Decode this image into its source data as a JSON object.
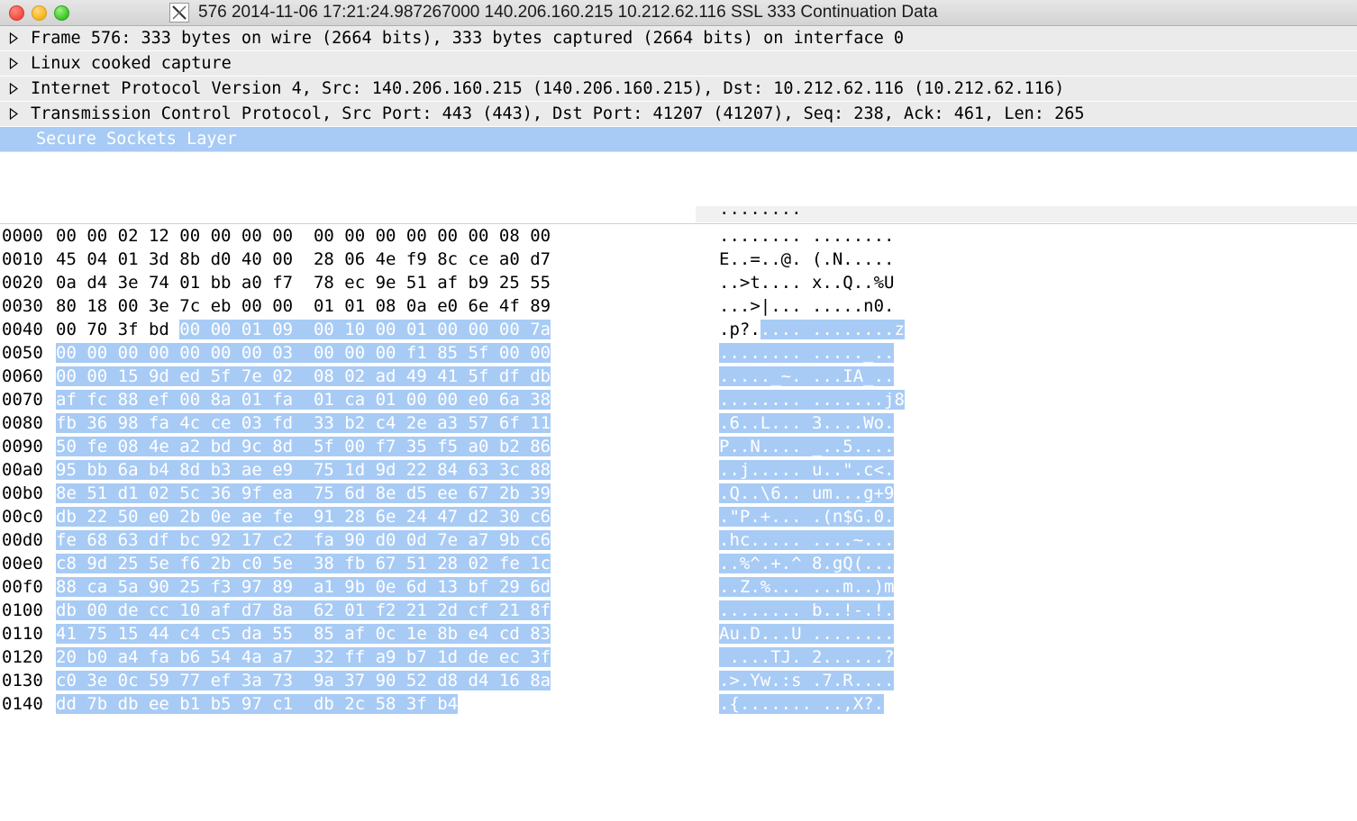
{
  "window": {
    "title": "576 2014-11-06 17:21:24.987267000 140.206.160.215 10.212.62.116 SSL 333 Continuation Data",
    "app_icon": "x11-icon",
    "buttons": {
      "close": "close-button",
      "minimize": "minimize-button",
      "maximize": "maximize-button"
    }
  },
  "colors": {
    "selection_blue": "#a8cbf5",
    "row_gray": "#ebebeb",
    "titlebar": "#dcdcdc",
    "close_red": "#f24b42",
    "minimize_yellow": "#f5b51b",
    "maximize_green": "#3bc428"
  },
  "protocol_tree": {
    "rows": [
      {
        "label": "Frame 576: 333 bytes on wire (2664 bits), 333 bytes captured (2664 bits) on interface 0",
        "expanded": false,
        "selected": false,
        "disclosure": "triangle-right-icon"
      },
      {
        "label": "Linux cooked capture",
        "expanded": false,
        "selected": false,
        "disclosure": "triangle-right-icon"
      },
      {
        "label": "Internet Protocol Version 4, Src: 140.206.160.215 (140.206.160.215), Dst: 10.212.62.116 (10.212.62.116)",
        "expanded": false,
        "selected": false,
        "disclosure": "triangle-right-icon"
      },
      {
        "label": "Transmission Control Protocol, Src Port: 443 (443), Dst Port: 41207 (41207), Seq: 238, Ack: 461, Len: 265",
        "expanded": false,
        "selected": false,
        "disclosure": "triangle-right-icon"
      },
      {
        "label": "Secure Sockets Layer",
        "expanded": false,
        "selected": true,
        "disclosure": "none"
      }
    ]
  },
  "hex_dump": {
    "clipped_top_row_ascii": "........",
    "rows": [
      {
        "offset": "0000",
        "bytes_plain": "00 00 02 12 00 00 00 00  00 00 00 00 00 00 08 00",
        "bytes_sel": "",
        "ascii_plain": "........ ........",
        "ascii_sel": ""
      },
      {
        "offset": "0010",
        "bytes_plain": "45 04 01 3d 8b d0 40 00  28 06 4e f9 8c ce a0 d7",
        "bytes_sel": "",
        "ascii_plain": "E..=..@. (.N.....",
        "ascii_sel": ""
      },
      {
        "offset": "0020",
        "bytes_plain": "0a d4 3e 74 01 bb a0 f7  78 ec 9e 51 af b9 25 55",
        "bytes_sel": "",
        "ascii_plain": "..>t.... x..Q..%U",
        "ascii_sel": ""
      },
      {
        "offset": "0030",
        "bytes_plain": "80 18 00 3e 7c eb 00 00  01 01 08 0a e0 6e 4f 89",
        "bytes_sel": "",
        "ascii_plain": "...>|... .....n0.",
        "ascii_sel": ""
      },
      {
        "offset": "0040",
        "bytes_plain": "00 70 3f bd ",
        "bytes_sel": "00 00 01 09  00 10 00 01 00 00 00 7a",
        "ascii_plain": ".p?.",
        "ascii_sel": ".... ........z"
      },
      {
        "offset": "0050",
        "bytes_plain": "",
        "bytes_sel": "00 00 00 00 00 00 00 03  00 00 00 f1 85 5f 00 00",
        "ascii_plain": "",
        "ascii_sel": "........ ....._.."
      },
      {
        "offset": "0060",
        "bytes_plain": "",
        "bytes_sel": "00 00 15 9d ed 5f 7e 02  08 02 ad 49 41 5f df db",
        "ascii_plain": "",
        "ascii_sel": "....._~. ...IA_.."
      },
      {
        "offset": "0070",
        "bytes_plain": "",
        "bytes_sel": "af fc 88 ef 00 8a 01 fa  01 ca 01 00 00 e0 6a 38",
        "ascii_plain": "",
        "ascii_sel": "........ .......j8"
      },
      {
        "offset": "0080",
        "bytes_plain": "",
        "bytes_sel": "fb 36 98 fa 4c ce 03 fd  33 b2 c4 2e a3 57 6f 11",
        "ascii_plain": "",
        "ascii_sel": ".6..L... 3....Wo."
      },
      {
        "offset": "0090",
        "bytes_plain": "",
        "bytes_sel": "50 fe 08 4e a2 bd 9c 8d  5f 00 f7 35 f5 a0 b2 86",
        "ascii_plain": "",
        "ascii_sel": "P..N.... _..5...."
      },
      {
        "offset": "00a0",
        "bytes_plain": "",
        "bytes_sel": "95 bb 6a b4 8d b3 ae e9  75 1d 9d 22 84 63 3c 88",
        "ascii_plain": "",
        "ascii_sel": "..j..... u..\".c<."
      },
      {
        "offset": "00b0",
        "bytes_plain": "",
        "bytes_sel": "8e 51 d1 02 5c 36 9f ea  75 6d 8e d5 ee 67 2b 39",
        "ascii_plain": "",
        "ascii_sel": ".Q..\\6.. um...g+9"
      },
      {
        "offset": "00c0",
        "bytes_plain": "",
        "bytes_sel": "db 22 50 e0 2b 0e ae fe  91 28 6e 24 47 d2 30 c6",
        "ascii_plain": "",
        "ascii_sel": ".\"P.+... .(n$G.0."
      },
      {
        "offset": "00d0",
        "bytes_plain": "",
        "bytes_sel": "fe 68 63 df bc 92 17 c2  fa 90 d0 0d 7e a7 9b c6",
        "ascii_plain": "",
        "ascii_sel": ".hc..... ....~..."
      },
      {
        "offset": "00e0",
        "bytes_plain": "",
        "bytes_sel": "c8 9d 25 5e f6 2b c0 5e  38 fb 67 51 28 02 fe 1c",
        "ascii_plain": "",
        "ascii_sel": "..%^.+.^ 8.gQ(..."
      },
      {
        "offset": "00f0",
        "bytes_plain": "",
        "bytes_sel": "88 ca 5a 90 25 f3 97 89  a1 9b 0e 6d 13 bf 29 6d",
        "ascii_plain": "",
        "ascii_sel": "..Z.%... ...m..)m"
      },
      {
        "offset": "0100",
        "bytes_plain": "",
        "bytes_sel": "db 00 de cc 10 af d7 8a  62 01 f2 21 2d cf 21 8f",
        "ascii_plain": "",
        "ascii_sel": "........ b..!-.!."
      },
      {
        "offset": "0110",
        "bytes_plain": "",
        "bytes_sel": "41 75 15 44 c4 c5 da 55  85 af 0c 1e 8b e4 cd 83",
        "ascii_plain": "",
        "ascii_sel": "Au.D...U ........"
      },
      {
        "offset": "0120",
        "bytes_plain": "",
        "bytes_sel": "20 b0 a4 fa b6 54 4a a7  32 ff a9 b7 1d de ec 3f",
        "ascii_plain": "",
        "ascii_sel": " ....TJ. 2......?"
      },
      {
        "offset": "0130",
        "bytes_plain": "",
        "bytes_sel": "c0 3e 0c 59 77 ef 3a 73  9a 37 90 52 d8 d4 16 8a",
        "ascii_plain": "",
        "ascii_sel": ".>.Yw.:s .7.R...."
      },
      {
        "offset": "0140",
        "bytes_plain": "",
        "bytes_sel": "dd 7b db ee b1 b5 97 c1  db 2c 58 3f b4",
        "ascii_plain": "",
        "ascii_sel": ".{....... ..,X?."
      }
    ]
  }
}
